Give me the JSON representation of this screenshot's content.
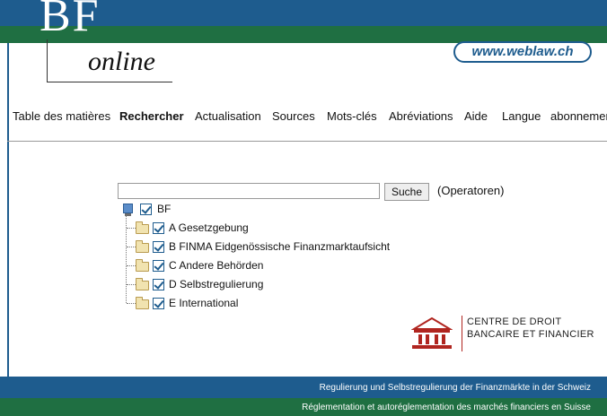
{
  "header": {
    "logo_bf": "BF",
    "logo_online": "online",
    "weblaw": "www.weblaw.ch"
  },
  "nav": [
    {
      "label": "Table des matières",
      "active": false
    },
    {
      "label": "Rechercher",
      "active": true
    },
    {
      "label": "Actualisation",
      "active": false
    },
    {
      "label": "Sources",
      "active": false
    },
    {
      "label": "Mots-clés",
      "active": false
    },
    {
      "label": "Abréviations",
      "active": false
    },
    {
      "label": "Aide",
      "active": false
    },
    {
      "label": "Langue",
      "active": false
    },
    {
      "label": "abonnement",
      "active": false
    }
  ],
  "search": {
    "value": "",
    "button_label": "Suche",
    "operators_label": "(Operatoren)"
  },
  "tree": {
    "root": {
      "label": "BF",
      "checked": true
    },
    "items": [
      {
        "label": "A Gesetzgebung",
        "checked": true
      },
      {
        "label": "B FINMA Eidgenössische Finanzmarktaufsicht",
        "checked": true
      },
      {
        "label": "C Andere Behörden",
        "checked": true
      },
      {
        "label": "D Selbstregulierung",
        "checked": true
      },
      {
        "label": "E International",
        "checked": true
      }
    ]
  },
  "cdbf": {
    "line1": "CENTRE DE DROIT",
    "line2": "BANCAIRE ET FINANCIER"
  },
  "footer": {
    "line_de": "Regulierung und Selbstregulierung der Finanzmärkte in der Schweiz",
    "line_fr": "Réglementation et autoréglementation des marchés financiers en Suisse"
  },
  "colors": {
    "blue": "#1e5c8e",
    "green": "#1f6f42",
    "cdbf_red": "#b0251f"
  },
  "icons": {
    "root": "network-computer-icon",
    "folder": "folder-icon",
    "checkbox": "checkbox-checked-icon"
  }
}
